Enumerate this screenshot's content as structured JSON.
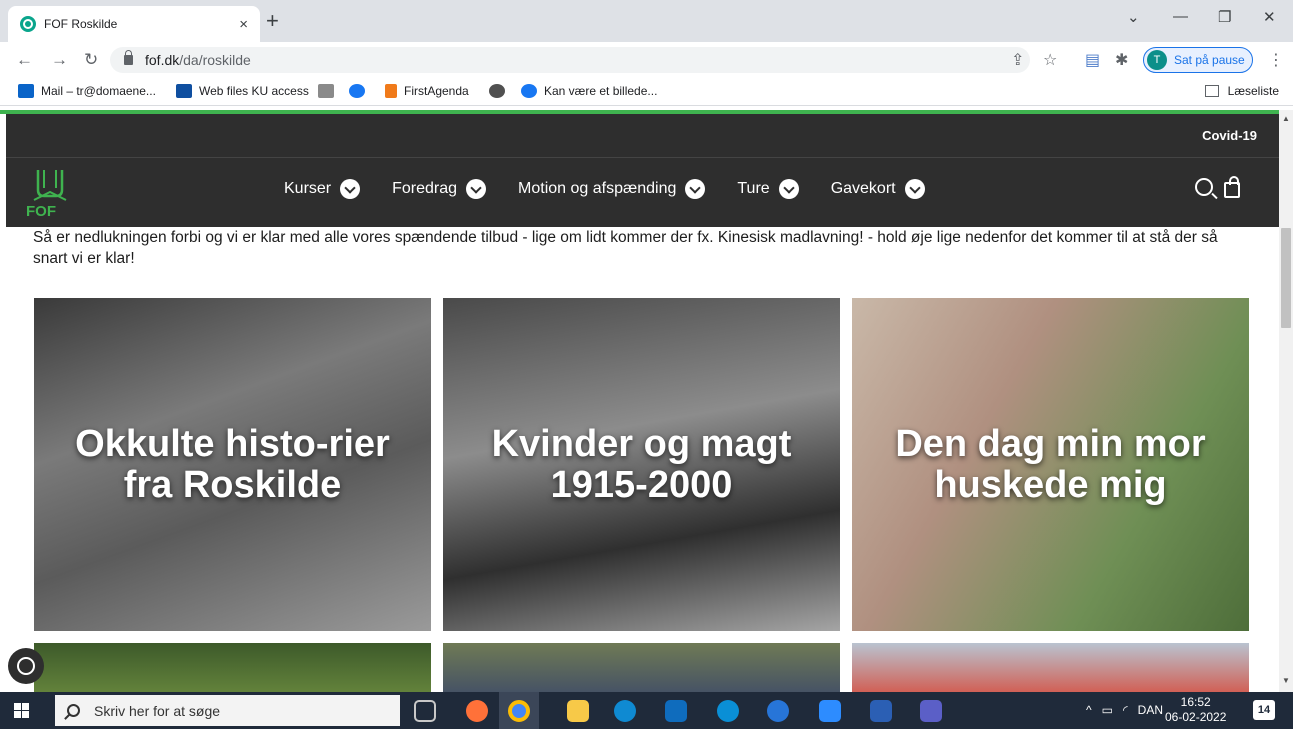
{
  "browser": {
    "tab_title": "FOF Roskilde",
    "tab_close": "×",
    "new_tab": "+",
    "url_host": "fof.dk",
    "url_path": "/da/roskilde",
    "profile_initial": "T",
    "profile_label": "Sat på pause",
    "bookmarks": [
      {
        "label": "Mail – tr@domaene...",
        "icon": "outlook-icon",
        "color": "#0a64c8"
      },
      {
        "label": "Web files KU access",
        "icon": "drive-icon",
        "color": "#0f4fa0"
      },
      {
        "label": "",
        "icon": "bank-icon",
        "color": "#8a8a8a"
      },
      {
        "label": "",
        "icon": "facebook-icon",
        "color": "#1877f2"
      },
      {
        "label": "FirstAgenda",
        "icon": "firstagenda-icon",
        "color": "#f07a1a"
      },
      {
        "label": "",
        "icon": "globe-icon",
        "color": "#505050"
      },
      {
        "label": "Kan være et billede...",
        "icon": "facebook-icon",
        "color": "#1877f2"
      }
    ],
    "reading_list": "Læseliste"
  },
  "site": {
    "top_link": "Covid-19",
    "logo_text": "FOF",
    "menu": [
      {
        "label": "Kurser"
      },
      {
        "label": "Foredrag"
      },
      {
        "label": "Motion og afspænding"
      },
      {
        "label": "Ture"
      },
      {
        "label": "Gavekort"
      }
    ],
    "intro": "Så er nedlukningen forbi og vi er klar med alle vores spændende tilbud - lige om lidt kommer der fx. Kinesisk madlavning! - hold øje lige nedenfor det kommer til at stå der så snart vi er klar!",
    "cards": [
      {
        "title": "Okkulte histo-rier fra Roskilde"
      },
      {
        "title": "Kvinder og magt 1915-2000"
      },
      {
        "title": "Den dag min mor huskede mig"
      }
    ]
  },
  "taskbar": {
    "search_placeholder": "Skriv her for at søge",
    "language": "DAN",
    "time": "16:52",
    "date": "06-02-2022",
    "notifications": "14"
  },
  "colors": {
    "accent_green": "#3fb34f",
    "nav_bg": "#2e2e2e"
  }
}
